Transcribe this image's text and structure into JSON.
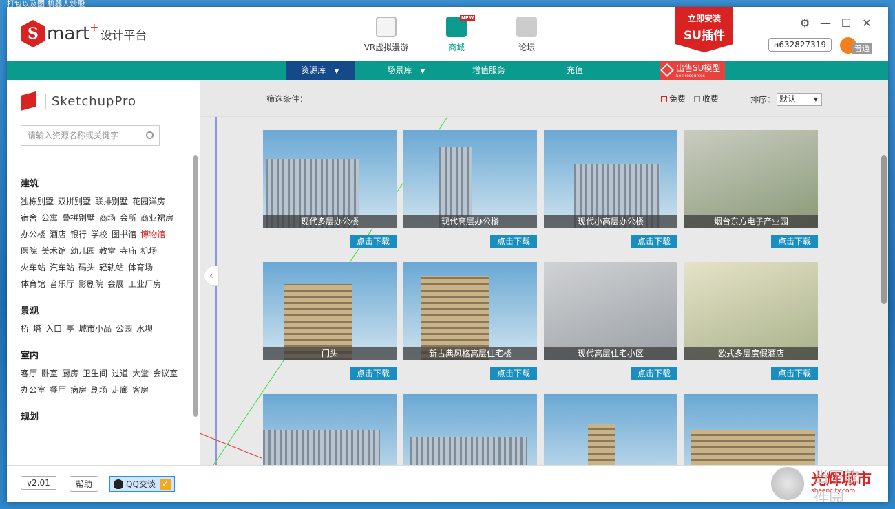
{
  "desktop": {
    "titlebar_text": "打包以及图  机器人炒股"
  },
  "app": {
    "logo_letter": "S",
    "logo_text": "mart",
    "logo_plus": "+",
    "logo_sub": "设计平台",
    "topnav": [
      {
        "label": "VR虚拟漫游"
      },
      {
        "label": "商城",
        "badge": "NEW"
      },
      {
        "label": "论坛"
      }
    ],
    "promo": {
      "line1": "立即安装",
      "line2": "SU插件"
    },
    "user_id": "a632827319",
    "user_name": "普通",
    "window_controls": [
      "gear-icon",
      "minimize-icon",
      "maximize-icon",
      "close-icon"
    ]
  },
  "nav": {
    "items": [
      {
        "label": "资源库"
      },
      {
        "label": "场景库"
      },
      {
        "label": "增值服务"
      },
      {
        "label": "充值"
      }
    ],
    "sell": {
      "label": "出售SU模型",
      "sub": "Sell resources"
    }
  },
  "sidebar": {
    "brand": "SketchupPro",
    "search_placeholder": "请输入资源名称或关键字",
    "categories": [
      {
        "title": "建筑",
        "tags": [
          "独栋别墅",
          "双拼别墅",
          "联排别墅",
          "花园洋房",
          "宿舍",
          "公寓",
          "叠拼别墅",
          "商场",
          "会所",
          "商业裙房",
          "办公楼",
          "酒店",
          "银行",
          "学校",
          "图书馆",
          "博物馆",
          "医院",
          "美术馆",
          "幼儿园",
          "教堂",
          "寺庙",
          "机场",
          "火车站",
          "汽车站",
          "码头",
          "轻轨站",
          "体育场",
          "体育馆",
          "音乐厅",
          "影剧院",
          "会展",
          "工业厂房"
        ]
      },
      {
        "title": "景观",
        "tags": [
          "桥",
          "塔",
          "入口",
          "亭",
          "城市小品",
          "公园",
          "水坝"
        ]
      },
      {
        "title": "室内",
        "tags": [
          "客厅",
          "卧室",
          "厨房",
          "卫生间",
          "过道",
          "大堂",
          "会议室",
          "办公室",
          "餐厅",
          "病房",
          "剧场",
          "走廊",
          "客房"
        ]
      },
      {
        "title": "规划",
        "tags": []
      }
    ]
  },
  "filter": {
    "label": "筛选条件：",
    "free": "免费",
    "paid": "收费",
    "sort_label": "排序：",
    "sort_value": "默认"
  },
  "grid": {
    "download_label": "点击下载",
    "items": [
      {
        "title": "现代多层办公楼"
      },
      {
        "title": "现代高层办公楼"
      },
      {
        "title": "现代小高层办公楼"
      },
      {
        "title": "烟台东方电子产业园"
      },
      {
        "title": "门头"
      },
      {
        "title": "新古典风格高层住宅楼"
      },
      {
        "title": "现代高层住宅小区"
      },
      {
        "title": "欧式多层度假酒店"
      },
      {
        "title": ""
      },
      {
        "title": ""
      },
      {
        "title": ""
      },
      {
        "title": ""
      }
    ]
  },
  "footer": {
    "version": "v2.01",
    "help": "帮助",
    "qq": "QQ交谈"
  },
  "watermark": {
    "line1": "光辉城市",
    "line2": "sheencity.com",
    "line3": "当下软件园"
  }
}
